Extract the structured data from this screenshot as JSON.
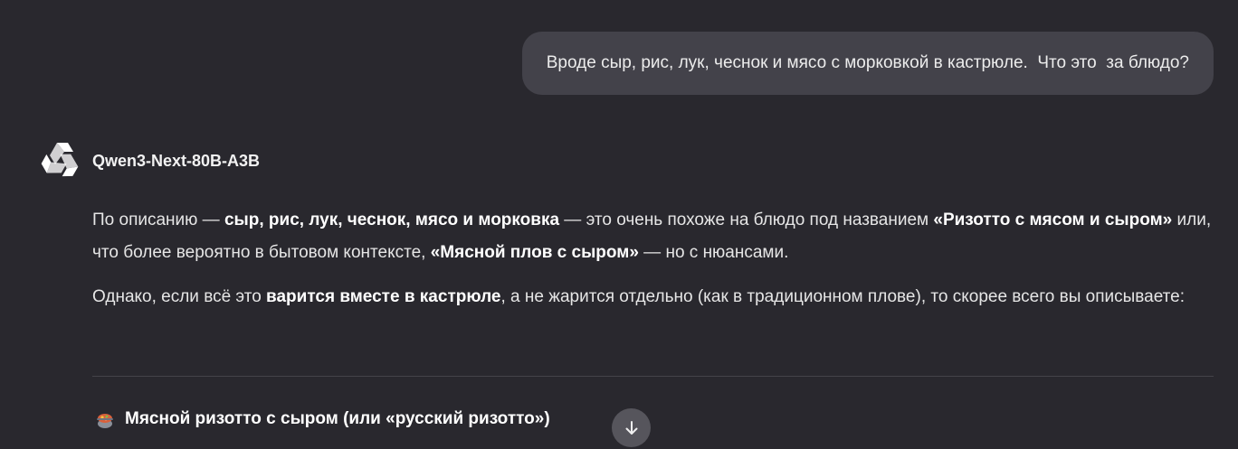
{
  "user_message": {
    "text": "Вроде сыр, рис, лук, чеснок и мясо с морковкой в кастрюле.  Что это  за блюдо?"
  },
  "model": {
    "name": "Qwen3-Next-80B-A3B",
    "logo_icon": "qwen-logo-icon"
  },
  "answer": {
    "p1": {
      "t1": "По описанию — ",
      "b1": "сыр, рис, лук, чеснок, мясо и морковка",
      "t2": " — это очень похоже на блюдо под названием ",
      "b2": "«Ризотто с мясом и сыром»",
      "t3": " или, что более вероятно в бытовом контексте, ",
      "b3": "«Мясной плов с сыром»",
      "t4": " — но с нюансами."
    },
    "p2": {
      "t1": "Однако, если всё это ",
      "b1": "варится вместе в кастрюле",
      "t2": ", а не жарится отдельно (как в традиционном плове), то скорее всего вы описываете:"
    },
    "section_heading": "Мясной ризотто с сыром (или «русский ризотто»)",
    "section_icon": "stew-pot-emoji-icon"
  },
  "scroll_button": {
    "icon": "arrow-down-icon"
  },
  "colors": {
    "background": "#29282e",
    "user_bubble": "#43424a",
    "text": "#e6e6e6",
    "bold_text": "#ffffff",
    "divider": "#44434a",
    "scroll_button": "#56555c"
  }
}
